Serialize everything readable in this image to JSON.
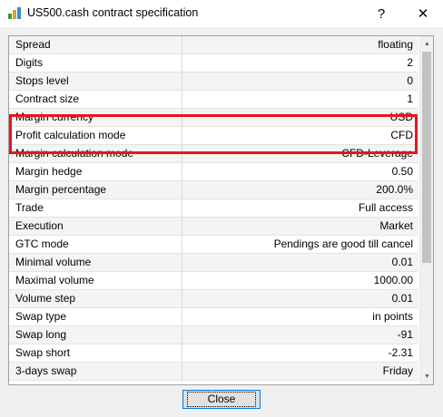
{
  "window": {
    "title": "US500.cash contract specification",
    "help_glyph": "?",
    "close_glyph": "✕"
  },
  "spec_rows": [
    {
      "name": "Spread",
      "value": "floating"
    },
    {
      "name": "Digits",
      "value": "2"
    },
    {
      "name": "Stops level",
      "value": "0"
    },
    {
      "name": "Contract size",
      "value": "1"
    },
    {
      "name": "Margin currency",
      "value": "USD"
    },
    {
      "name": "Profit calculation mode",
      "value": "CFD"
    },
    {
      "name": "Margin calculation mode",
      "value": "CFD-Leverage"
    },
    {
      "name": "Margin hedge",
      "value": "0.50"
    },
    {
      "name": "Margin percentage",
      "value": "200.0%"
    },
    {
      "name": "Trade",
      "value": "Full access"
    },
    {
      "name": "Execution",
      "value": "Market"
    },
    {
      "name": "GTC mode",
      "value": "Pendings are good till cancel"
    },
    {
      "name": "Minimal volume",
      "value": "0.01"
    },
    {
      "name": "Maximal volume",
      "value": "1000.00"
    },
    {
      "name": "Volume step",
      "value": "0.01"
    },
    {
      "name": "Swap type",
      "value": "in points"
    },
    {
      "name": "Swap long",
      "value": "-91"
    },
    {
      "name": "Swap short",
      "value": "-2.31"
    },
    {
      "name": "3-days swap",
      "value": "Friday"
    }
  ],
  "highlight": {
    "color": "#e8141e",
    "rows": [
      "Contract size",
      "Margin currency"
    ]
  },
  "scrollbar": {
    "up_glyph": "▲",
    "down_glyph": "▼",
    "scroll_fraction_visible": 0.65
  },
  "footer": {
    "close_label": "Close"
  },
  "colors": {
    "accent": "#0078d7",
    "highlight": "#e8141e"
  }
}
